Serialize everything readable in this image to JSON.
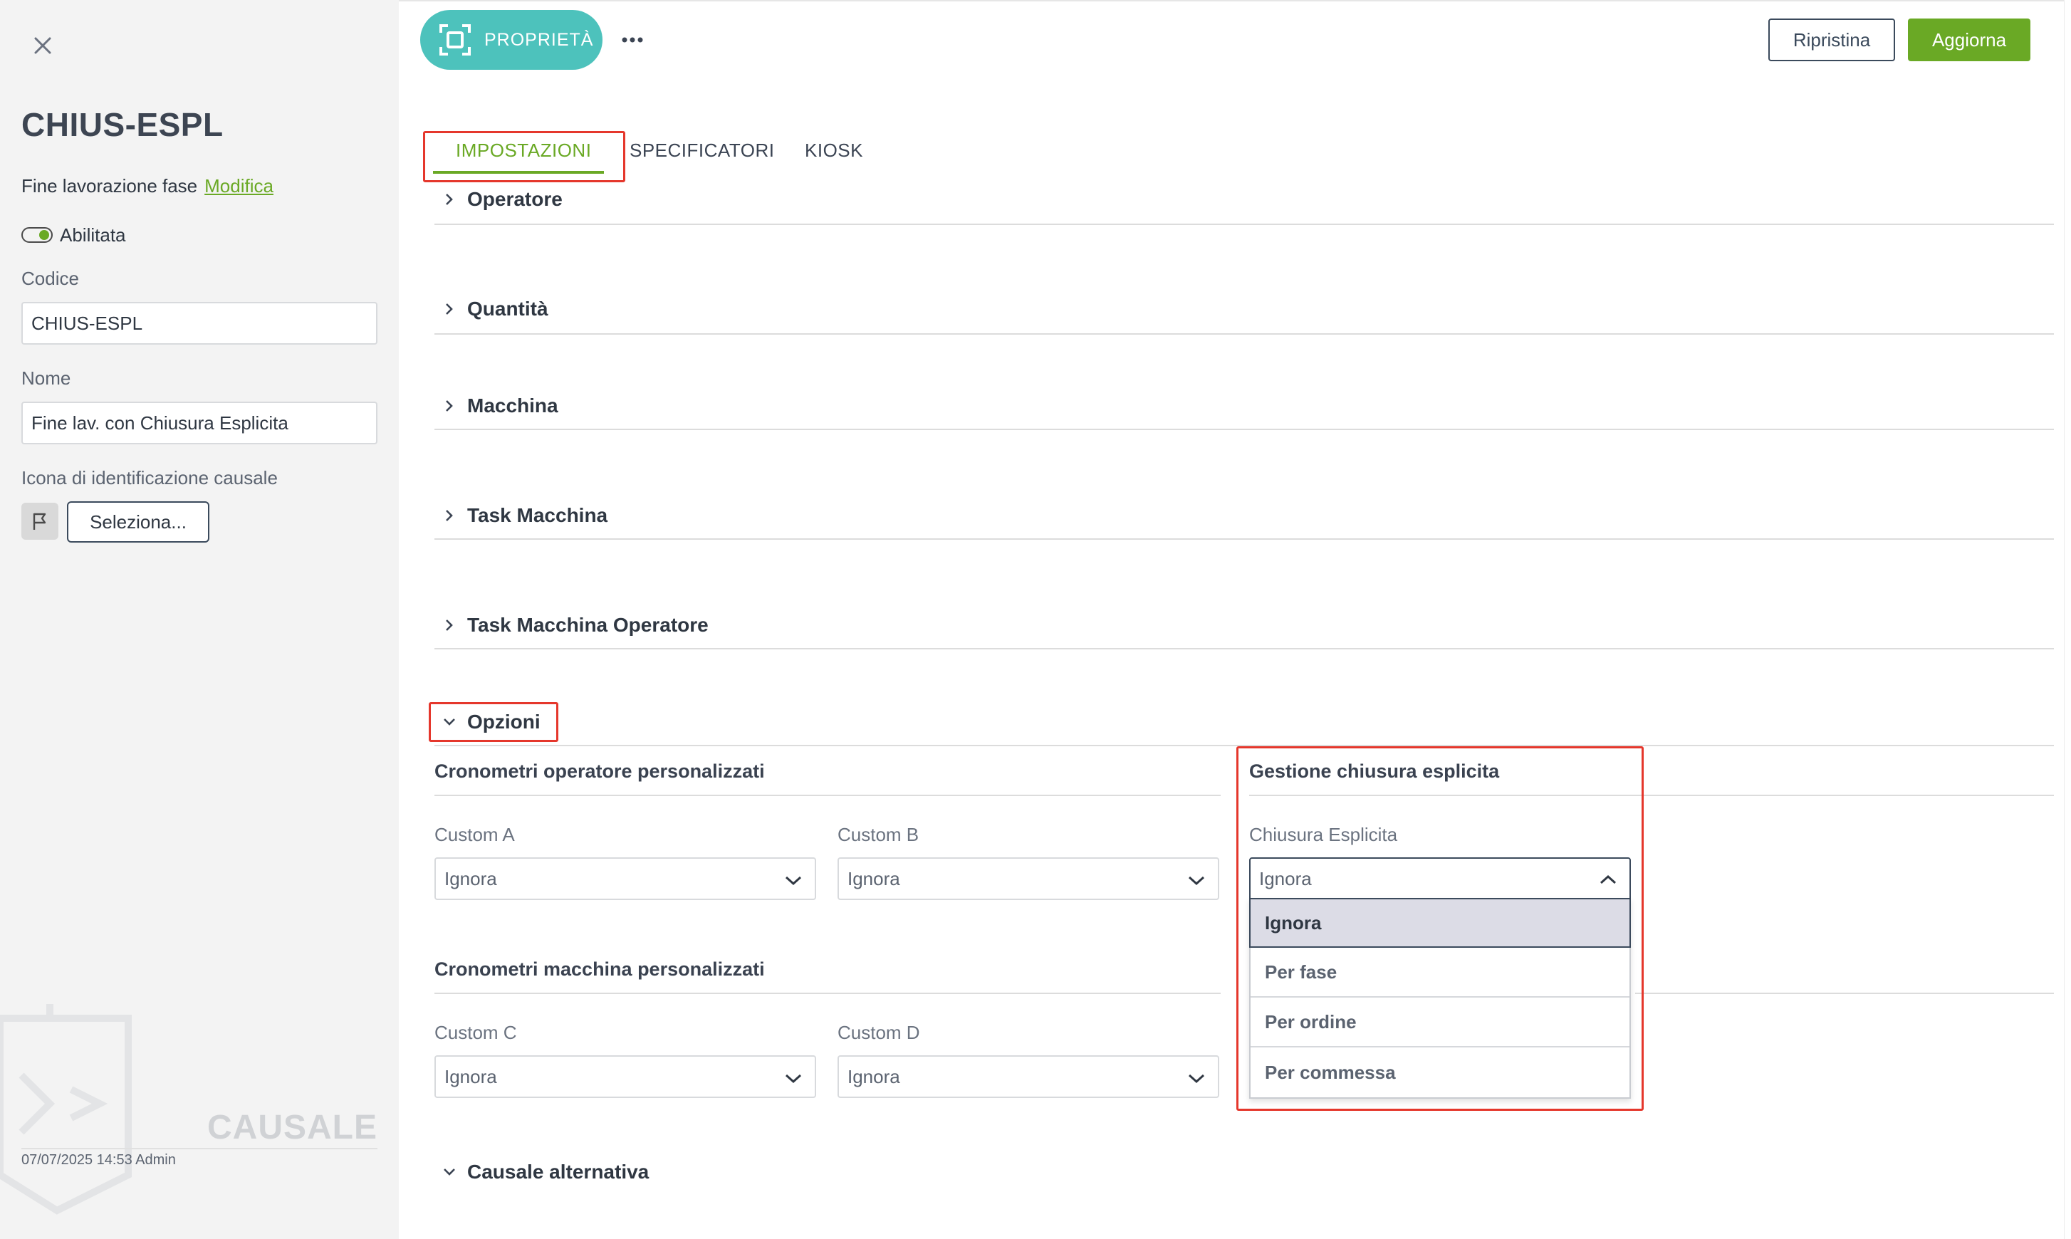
{
  "left_panel": {
    "title": "CHIUS-ESPL",
    "type_label": "Fine lavorazione fase",
    "type_link": "Modifica",
    "enabled_label": "Abilitata",
    "code_label": "Codice",
    "code_value": "CHIUS-ESPL",
    "name_label": "Nome",
    "name_value": "Fine lav. con Chiusura Esplicita",
    "icon_label": "Icona di identificazione causale",
    "icon_button": "Seleziona...",
    "watermark": "CAUSALE",
    "footer_meta": "07/07/2025 14:53 Admin"
  },
  "toolbar": {
    "properties_label": "PROPRIETÀ",
    "reset_label": "Ripristina",
    "update_label": "Aggiorna"
  },
  "tabs": [
    {
      "label": "IMPOSTAZIONI",
      "active": true
    },
    {
      "label": "SPECIFICATORI",
      "active": false
    },
    {
      "label": "KIOSK",
      "active": false
    }
  ],
  "sections": {
    "operatore": "Operatore",
    "quantita": "Quantità",
    "macchina": "Macchina",
    "task_macchina": "Task Macchina",
    "task_macchina_operatore": "Task Macchina Operatore",
    "opzioni": "Opzioni",
    "causale_alternativa": "Causale alternativa"
  },
  "options": {
    "operator_timers_title": "Cronometri operatore personalizzati",
    "machine_timers_title": "Cronometri macchina personalizzati",
    "explicit_close_title": "Gestione chiusura esplicita",
    "custom_a": {
      "label": "Custom A",
      "value": "Ignora"
    },
    "custom_b": {
      "label": "Custom B",
      "value": "Ignora"
    },
    "custom_c": {
      "label": "Custom C",
      "value": "Ignora"
    },
    "custom_d": {
      "label": "Custom D",
      "value": "Ignora"
    },
    "explicit_close": {
      "label": "Chiusura Esplicita",
      "value": "Ignora",
      "options": [
        "Ignora",
        "Per fase",
        "Per ordine",
        "Per commessa"
      ]
    }
  },
  "colors": {
    "accent_green": "#6aa925",
    "teal": "#4dc2bc",
    "highlight_red": "#e5372c"
  }
}
